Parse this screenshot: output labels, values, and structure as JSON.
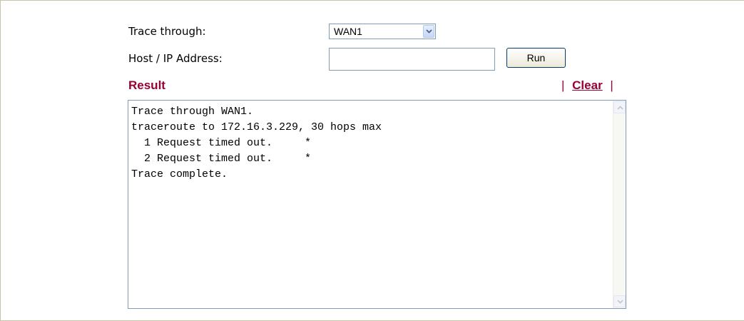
{
  "form": {
    "trace_label": "Trace through:",
    "trace_value": "WAN1",
    "host_label": "Host / IP Address:",
    "host_value": "",
    "host_placeholder": "",
    "run_label": "Run"
  },
  "result": {
    "heading": "Result",
    "separator": "|",
    "clear_label": "Clear",
    "output": "Trace through WAN1.\ntraceroute to 172.16.3.229, 30 hops max\n  1 Request timed out.     *\n  2 Request timed out.     *\nTrace complete."
  },
  "icons": {
    "select_arrow": "chevron-down-icon",
    "scroll_up": "scroll-up-arrow-icon",
    "scroll_down": "scroll-down-arrow-icon"
  },
  "colors": {
    "accent": "#990033",
    "input_border": "#7f9db9"
  }
}
